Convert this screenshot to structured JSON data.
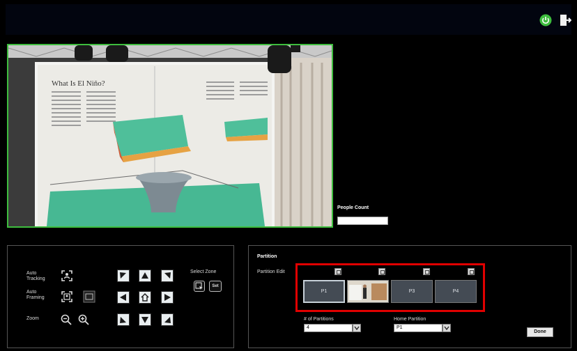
{
  "header": {
    "icons": [
      "power-icon",
      "exit-icon"
    ],
    "power_color": "#3ebd3e"
  },
  "video": {
    "border_color": "#3ebd3e"
  },
  "people_count": {
    "label": "People Count",
    "value": ""
  },
  "tracking": {
    "auto_tracking_label": "Auto Tracking",
    "auto_framing_label": "Auto Framing",
    "zoom_label": "Zoom",
    "select_zone_label": "Select Zone",
    "set_label": "Set"
  },
  "partition": {
    "title": "Partition",
    "edit_label": "Partition Edit",
    "tiles": [
      {
        "label": "P1",
        "selected": true
      },
      {
        "label": "",
        "thumbnail": true
      },
      {
        "label": "P3",
        "selected": false
      },
      {
        "label": "P4",
        "selected": false
      }
    ],
    "count_label": "# of Partitions",
    "count_value": "4",
    "home_label": "Home Partition",
    "home_value": "P1",
    "done_label": "Done",
    "highlight_color": "#e00000"
  }
}
